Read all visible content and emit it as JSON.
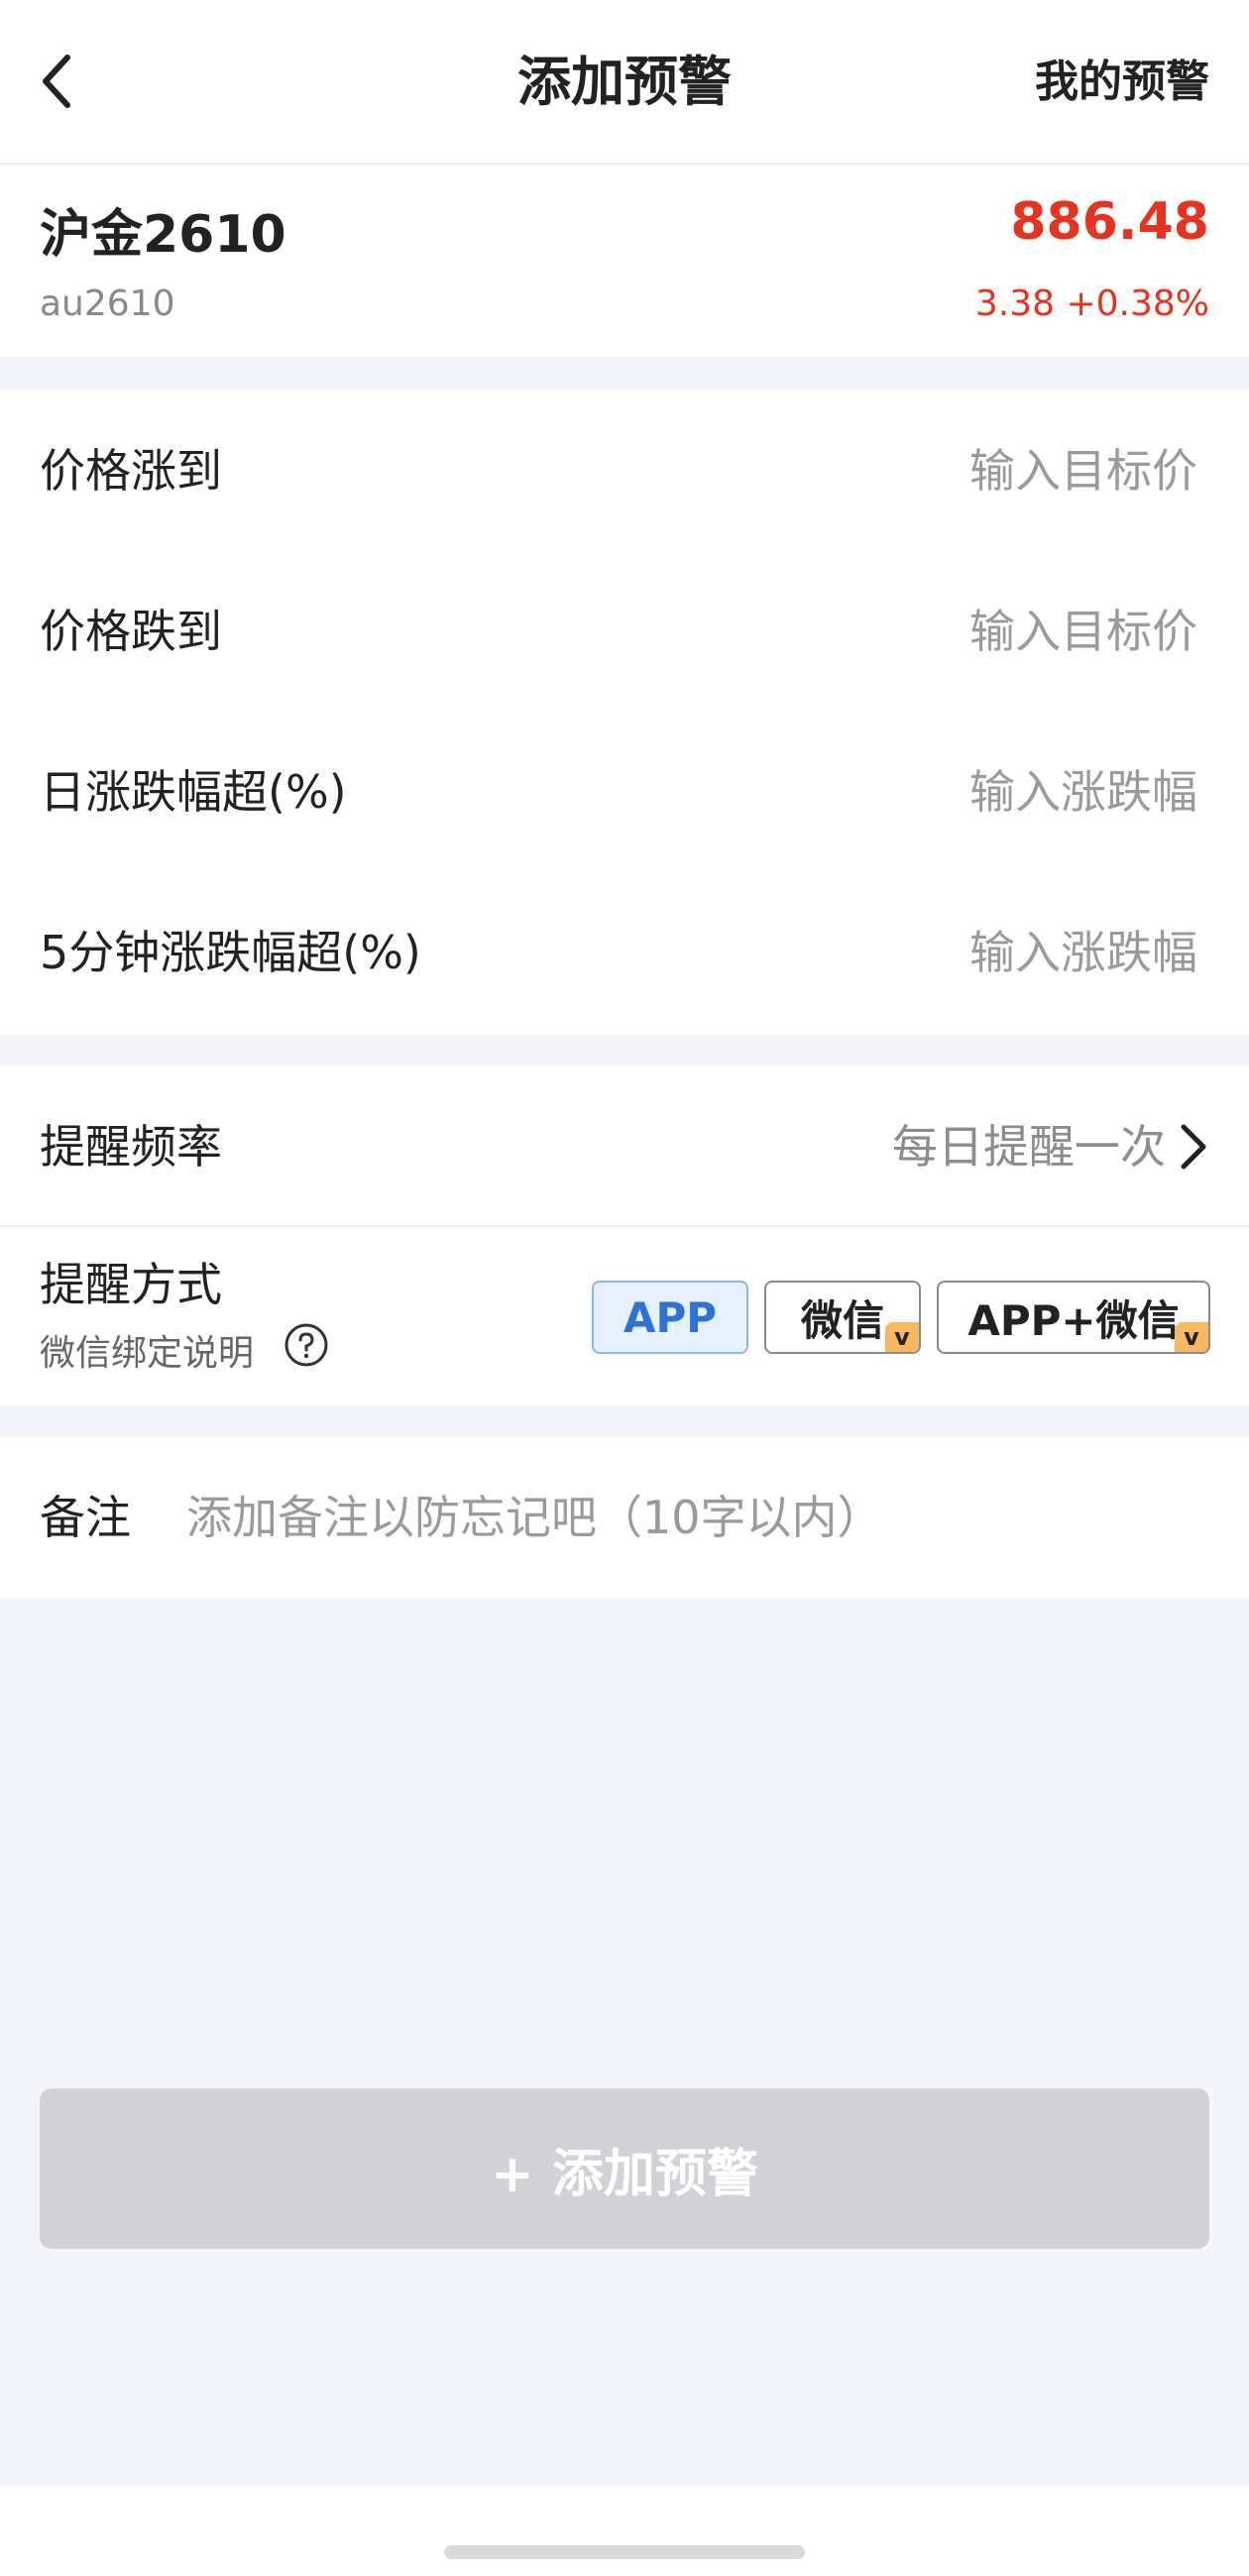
{
  "header": {
    "title": "添加预警",
    "my_alerts_label": "我的预警"
  },
  "instrument": {
    "name": "沪金2610",
    "code": "au2610",
    "price": "886.48",
    "change": "3.38 +0.38%",
    "up_color": "#e8311e"
  },
  "conditions": {
    "rise_label": "价格涨到",
    "rise_placeholder": "输入目标价",
    "fall_label": "价格跌到",
    "fall_placeholder": "输入目标价",
    "daily_label": "日涨跌幅超(%)",
    "daily_placeholder": "输入涨跌幅",
    "five_min_label": "5分钟涨跌幅超(%)",
    "five_min_placeholder": "输入涨跌幅"
  },
  "reminder": {
    "frequency_label": "提醒频率",
    "frequency_value": "每日提醒一次",
    "method_label": "提醒方式",
    "wechat_help_text": "微信绑定说明",
    "methods": [
      {
        "label": "APP",
        "selected": true,
        "vip": false
      },
      {
        "label": "微信",
        "selected": false,
        "vip": true
      },
      {
        "label": "APP+微信",
        "selected": false,
        "vip": true
      }
    ],
    "vip_badge_text": "v"
  },
  "note": {
    "label": "备注",
    "placeholder": "添加备注以防忘记吧（10字以内）"
  },
  "submit": {
    "label": "+ 添加预警",
    "enabled": false
  },
  "colors": {
    "accent_blue": "#2e72d9",
    "vip_orange": "#f7b85f",
    "disabled_button": "#d2d2d6"
  }
}
